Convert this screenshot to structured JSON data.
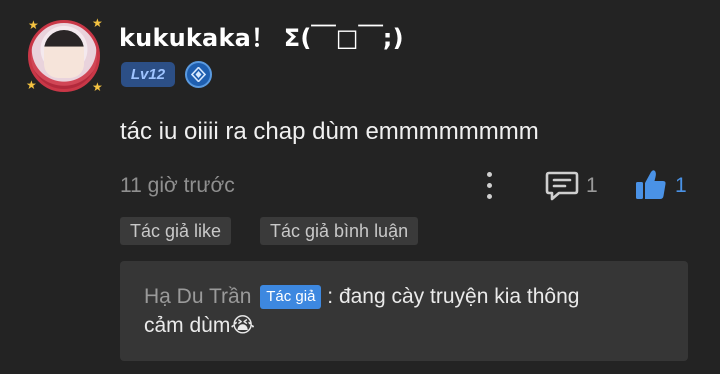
{
  "comment": {
    "username": "kukukaka！ Σ(￣□￣;)",
    "level": "Lv12",
    "text": "tác iu oiiii ra chap dùm emmmmmmmm",
    "time": "11 giờ trước",
    "reply_count": "1",
    "like_count": "1",
    "tags": [
      "Tác giả like",
      "Tác giả bình luận"
    ]
  },
  "reply": {
    "author": "Hạ Du Trần",
    "badge": "Tác giả",
    "text_line1": " : đang cày truyện kia thông",
    "text_line2": "cảm dùm😭"
  },
  "icons": {
    "avatar": "avatar-frame",
    "rank": "diamond-rank-icon",
    "more": "vertical-dots-icon",
    "reply": "comment-bubble-icon",
    "like": "thumbs-up-icon"
  },
  "colors": {
    "background": "#232323",
    "accent_blue": "#4a92e6",
    "badge_blue": "#3d88e0",
    "tag_bg": "#3a3a3a",
    "reply_bg": "#363636"
  }
}
